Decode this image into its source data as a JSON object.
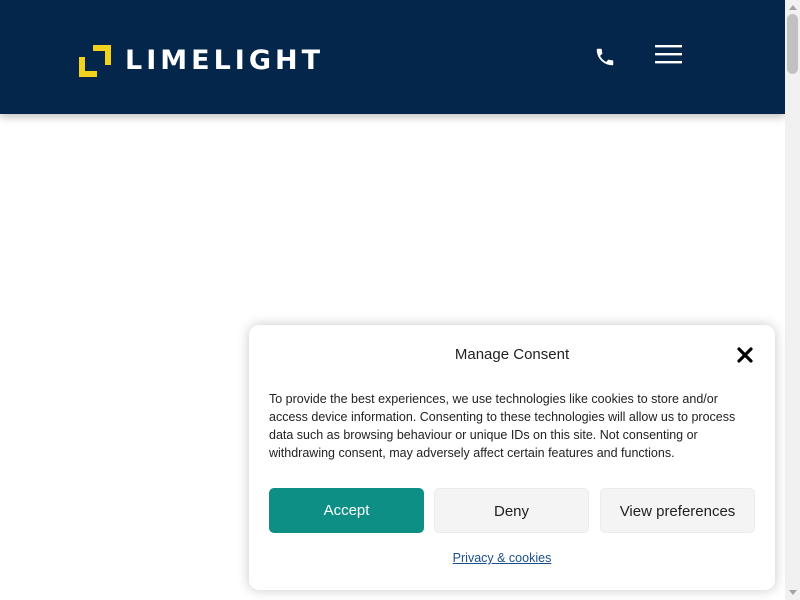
{
  "header": {
    "logo_text": "LIMELIGHT",
    "logo_icon": "corner-bracket-logo-mark",
    "phone_icon": "phone-icon",
    "menu_icon": "hamburger-menu-icon",
    "background_color": "#03264a",
    "accent_color": "#f2d21c"
  },
  "consent": {
    "title": "Manage Consent",
    "close_icon": "close-icon",
    "body": "To provide the best experiences, we use technologies like cookies to store and/or access device information. Consenting to these technologies will allow us to process data such as browsing behaviour or unique IDs on this site. Not consenting or withdrawing consent, may adversely affect certain features and functions.",
    "accept_label": "Accept",
    "deny_label": "Deny",
    "preferences_label": "View preferences",
    "privacy_link": "Privacy & cookies",
    "accept_color": "#0d8f86"
  }
}
